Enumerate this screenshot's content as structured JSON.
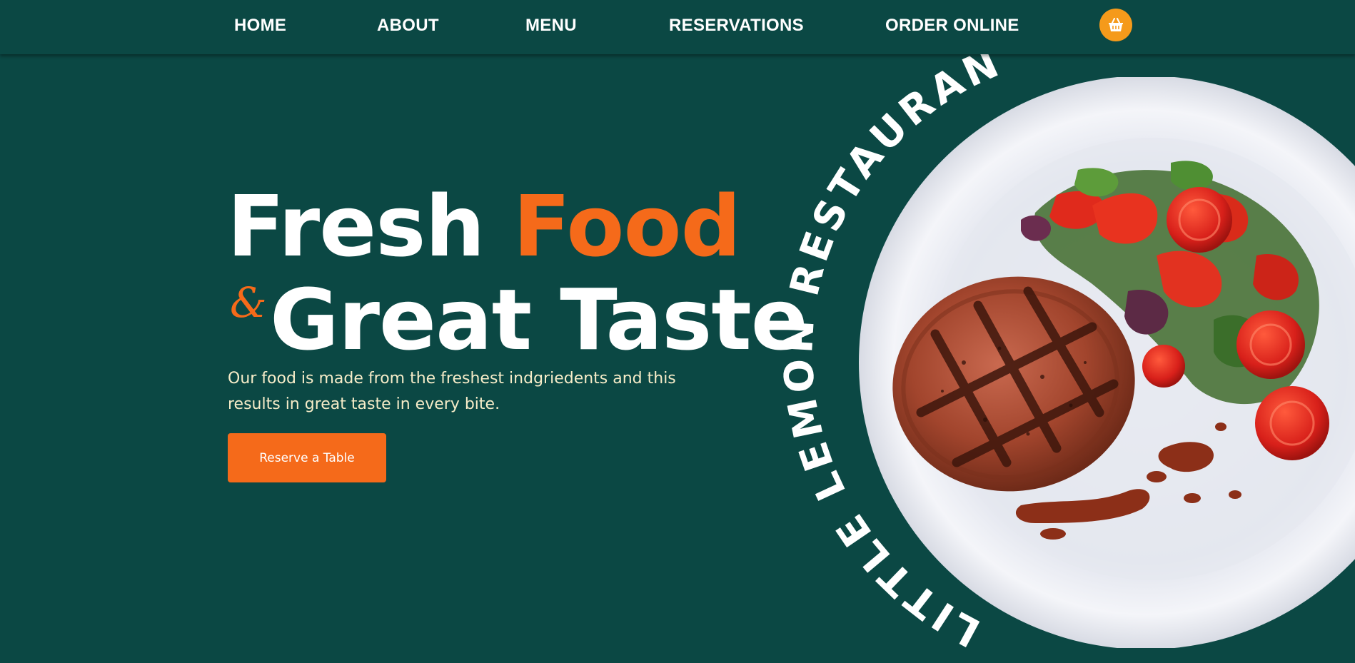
{
  "nav": {
    "items": [
      {
        "label": "HOME"
      },
      {
        "label": "ABOUT"
      },
      {
        "label": "MENU"
      },
      {
        "label": "RESERVATIONS"
      },
      {
        "label": "ORDER ONLINE"
      }
    ],
    "cart_icon": "basket-icon"
  },
  "hero": {
    "title_part1": "Fresh ",
    "title_accent": "Food",
    "ampersand": "&",
    "title_line2": "Great Taste",
    "description": "Our food is made from the freshest indgriedents and this results in great taste in every bite.",
    "button_label": "Reserve a Table",
    "circle_text": "LITTLE LEMON RESTAURANT"
  },
  "colors": {
    "background": "#0b4844",
    "accent_orange": "#f56a1a",
    "cart_orange": "#f59a1b",
    "text_light": "#f6ecc8"
  }
}
